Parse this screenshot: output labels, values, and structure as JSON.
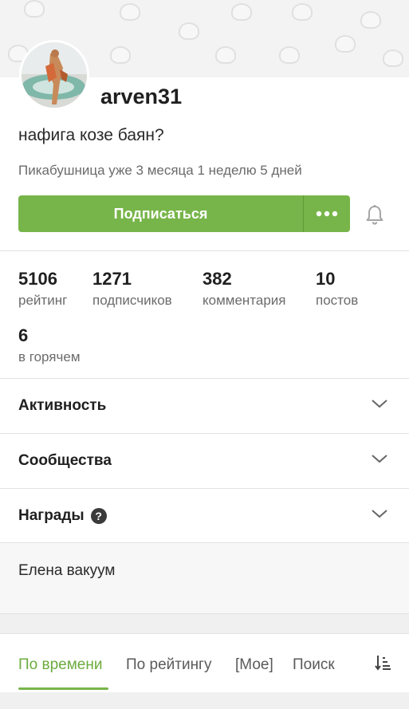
{
  "profile": {
    "username": "arven31",
    "status": "нафига козе баян?",
    "since": "Пикабушница уже 3 месяца 1 неделю 5 дней"
  },
  "actions": {
    "subscribe_label": "Подписаться",
    "more_icon": "more-dots-icon",
    "bell_icon": "bell-icon"
  },
  "stats": [
    {
      "value": "5106",
      "label": "рейтинг"
    },
    {
      "value": "1271",
      "label": "подписчиков"
    },
    {
      "value": "382",
      "label": "комментария"
    },
    {
      "value": "10",
      "label": "постов"
    },
    {
      "value": "6",
      "label": "в горячем"
    }
  ],
  "sections": [
    {
      "title": "Активность"
    },
    {
      "title": "Сообщества"
    },
    {
      "title": "Награды"
    }
  ],
  "help_glyph": "?",
  "about": "Елена вакуум",
  "tabs": [
    {
      "label": "По времени",
      "active": true
    },
    {
      "label": "По рейтингу"
    },
    {
      "label": "[Мое]"
    },
    {
      "label": "Поиск"
    }
  ],
  "colors": {
    "accent": "#77b54a",
    "accent_text": "#6cab3e",
    "text": "#1f1f1f",
    "muted": "#6b6b6b"
  }
}
